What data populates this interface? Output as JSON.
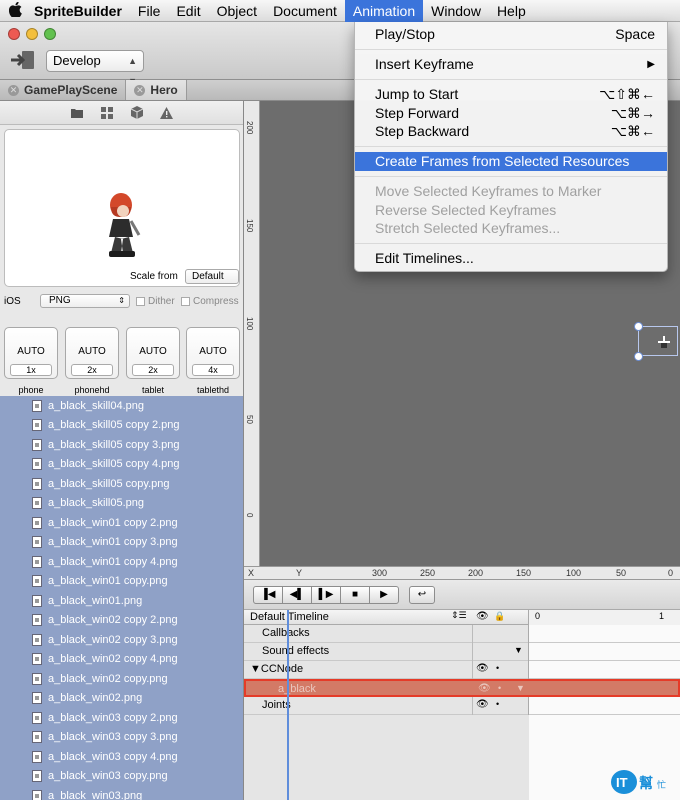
{
  "menubar": {
    "items": [
      "SpriteBuilder",
      "File",
      "Edit",
      "Object",
      "Document",
      "Animation",
      "Window",
      "Help"
    ]
  },
  "toolbar": {
    "target": "Develop"
  },
  "tabs": [
    "GamePlayScene",
    "Hero"
  ],
  "preview": {
    "scale_from_label": "Scale from",
    "scale_from_value": "Default",
    "platform": "iOS",
    "format": "PNG",
    "dither": "Dither",
    "compress": "Compress"
  },
  "resolutions": [
    {
      "auto": "AUTO",
      "mult": "1x",
      "name": "phone"
    },
    {
      "auto": "AUTO",
      "mult": "2x",
      "name": "phonehd"
    },
    {
      "auto": "AUTO",
      "mult": "2x",
      "name": "tablet"
    },
    {
      "auto": "AUTO",
      "mult": "4x",
      "name": "tablethd"
    }
  ],
  "files": [
    "a_black_skill04.png",
    "a_black_skill05 copy 2.png",
    "a_black_skill05 copy 3.png",
    "a_black_skill05 copy 4.png",
    "a_black_skill05 copy.png",
    "a_black_skill05.png",
    "a_black_win01 copy 2.png",
    "a_black_win01 copy 3.png",
    "a_black_win01 copy 4.png",
    "a_black_win01 copy.png",
    "a_black_win01.png",
    "a_black_win02 copy 2.png",
    "a_black_win02 copy 3.png",
    "a_black_win02 copy 4.png",
    "a_black_win02 copy.png",
    "a_black_win02.png",
    "a_black_win03 copy 2.png",
    "a_black_win03 copy 3.png",
    "a_black_win03 copy 4.png",
    "a_black_win03 copy.png",
    "a_black_win03.png"
  ],
  "vruler_labels": [
    "200",
    "150",
    "100",
    "50",
    "0"
  ],
  "hruler": {
    "x": "X",
    "y": "Y",
    "labels": [
      "300",
      "250",
      "200",
      "150",
      "100",
      "50",
      "0"
    ]
  },
  "timeline": {
    "name": "Default Timeline",
    "ruler_start": "0",
    "ruler_end": "1",
    "rows": [
      {
        "label": "Callbacks"
      },
      {
        "label": "Sound effects"
      },
      {
        "label": "▼CCNode"
      },
      {
        "label": "a_black"
      },
      {
        "label": "Joints"
      }
    ]
  },
  "animation_menu": {
    "items": [
      {
        "label": "Play/Stop",
        "shortcut": "Space"
      },
      {
        "label": "Insert Keyframe",
        "shortcut": "▶"
      },
      {
        "label": "Jump to Start",
        "shortcut": "⌥⇧⌘←"
      },
      {
        "label": "Step Forward",
        "shortcut": "⌥⌘→"
      },
      {
        "label": "Step Backward",
        "shortcut": "⌥⌘←"
      },
      {
        "label": "Create Frames from Selected Resources",
        "shortcut": ""
      },
      {
        "label": "Move Selected Keyframes to Marker",
        "shortcut": ""
      },
      {
        "label": "Reverse Selected Keyframes",
        "shortcut": ""
      },
      {
        "label": "Stretch Selected Keyframes...",
        "shortcut": ""
      },
      {
        "label": "Edit Timelines...",
        "shortcut": ""
      }
    ]
  },
  "watermark": "IT邦幫忙"
}
